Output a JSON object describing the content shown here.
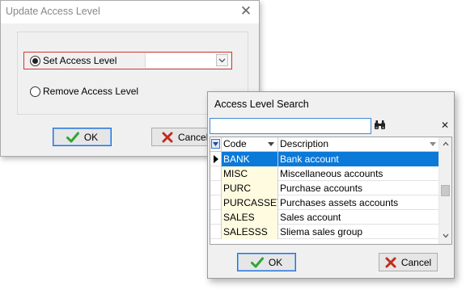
{
  "update_dialog": {
    "title": "Update Access Level",
    "set_option_label": "Set Access Level",
    "remove_option_label": "Remove Access Level",
    "access_level_value": "",
    "ok_label": "OK",
    "cancel_label": "Cancel"
  },
  "search_dialog": {
    "title": "Access Level Search",
    "search_value": "",
    "columns": [
      "Code",
      "Description"
    ],
    "rows": [
      {
        "code": "BANK",
        "description": "Bank account",
        "selected": true
      },
      {
        "code": "MISC",
        "description": "Miscellaneous accounts",
        "selected": false
      },
      {
        "code": "PURC",
        "description": "Purchase accounts",
        "selected": false
      },
      {
        "code": "PURCASSET",
        "description": "Purchases assets accounts",
        "selected": false
      },
      {
        "code": "SALES",
        "description": "Sales account",
        "selected": false
      },
      {
        "code": "SALESSS",
        "description": "Sliema sales group",
        "selected": false
      }
    ],
    "ok_label": "OK",
    "cancel_label": "Cancel"
  },
  "icons": {
    "close": "close-icon",
    "ok_check": "check-icon",
    "cancel_x": "x-icon",
    "binoculars": "binoculars-icon",
    "dropdown": "chevron-down-icon"
  },
  "colors": {
    "selection": "#0a79d8",
    "code_cell_bg": "#fffbe0",
    "highlight_border": "#d5352b",
    "ok_check": "#2fa53a",
    "cancel_x": "#c42b1c"
  }
}
